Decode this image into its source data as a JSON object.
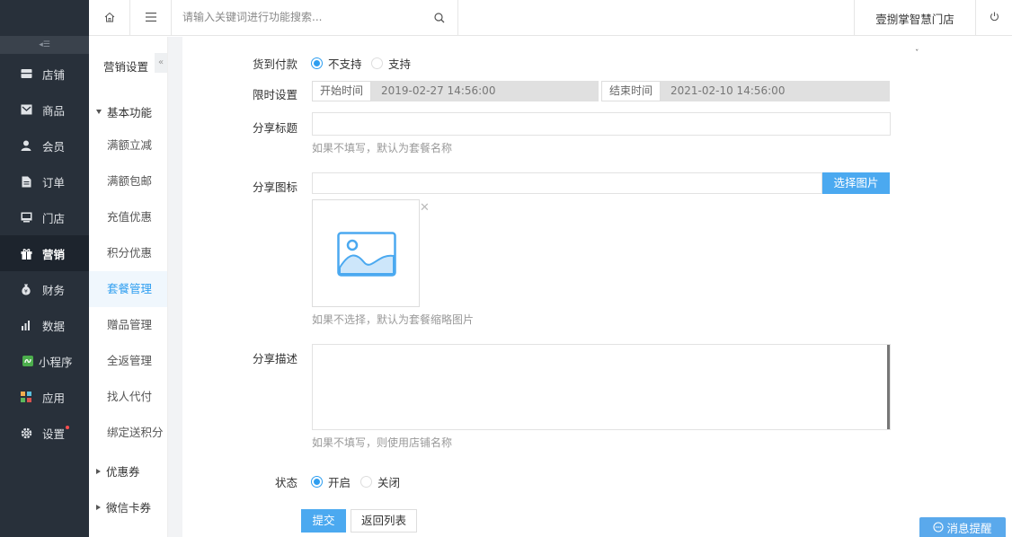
{
  "sidebar": {
    "items": [
      {
        "label": "店铺",
        "icon": "store-icon"
      },
      {
        "label": "商品",
        "icon": "goods-icon"
      },
      {
        "label": "会员",
        "icon": "member-icon"
      },
      {
        "label": "订单",
        "icon": "order-icon"
      },
      {
        "label": "门店",
        "icon": "shop-icon"
      },
      {
        "label": "营销",
        "icon": "gift-icon",
        "active": true
      },
      {
        "label": "财务",
        "icon": "money-bag-icon"
      },
      {
        "label": "数据",
        "icon": "chart-icon"
      },
      {
        "label": "小程序",
        "icon": "mini-program-icon"
      },
      {
        "label": "应用",
        "icon": "apps-icon"
      },
      {
        "label": "设置",
        "icon": "gear-icon",
        "badge": true
      }
    ]
  },
  "topbar": {
    "search_placeholder": "请输入关键词进行功能搜索...",
    "store_name": "壹捌掌智慧门店"
  },
  "submenu": {
    "title": "营销设置",
    "group_basic": "基本功能",
    "items": [
      "满额立减",
      "满额包邮",
      "充值优惠",
      "积分优惠",
      "套餐管理",
      "赠品管理",
      "全返管理",
      "找人代付",
      "绑定送积分"
    ],
    "active_item": "套餐管理",
    "group_coupon": "优惠券",
    "group_wxcard": "微信卡券"
  },
  "form": {
    "cod_label": "货到付款",
    "cod_options": [
      "不支持",
      "支持"
    ],
    "cod_selected": "不支持",
    "time_label": "限时设置",
    "start_addon": "开始时间",
    "start_value": "2019-02-27 14:56:00",
    "end_addon": "结束时间",
    "end_value": "2021-02-10 14:56:00",
    "share_title_label": "分享标题",
    "share_title_value": "",
    "share_title_hint": "如果不填写，默认为套餐名称",
    "share_icon_label": "分享图标",
    "select_image_button": "选择图片",
    "share_icon_hint": "如果不选择，默认为套餐缩略图片",
    "share_desc_label": "分享描述",
    "share_desc_hint": "如果不填写，则使用店铺名称",
    "status_label": "状态",
    "status_options": [
      "开启",
      "关闭"
    ],
    "status_selected": "开启",
    "submit_button": "提交",
    "back_button": "返回列表"
  },
  "message_button": "消息提醒",
  "colors": {
    "sidebar_bg": "#28303a",
    "accent": "#2e9ef0",
    "button_blue": "#4ba9f0"
  }
}
